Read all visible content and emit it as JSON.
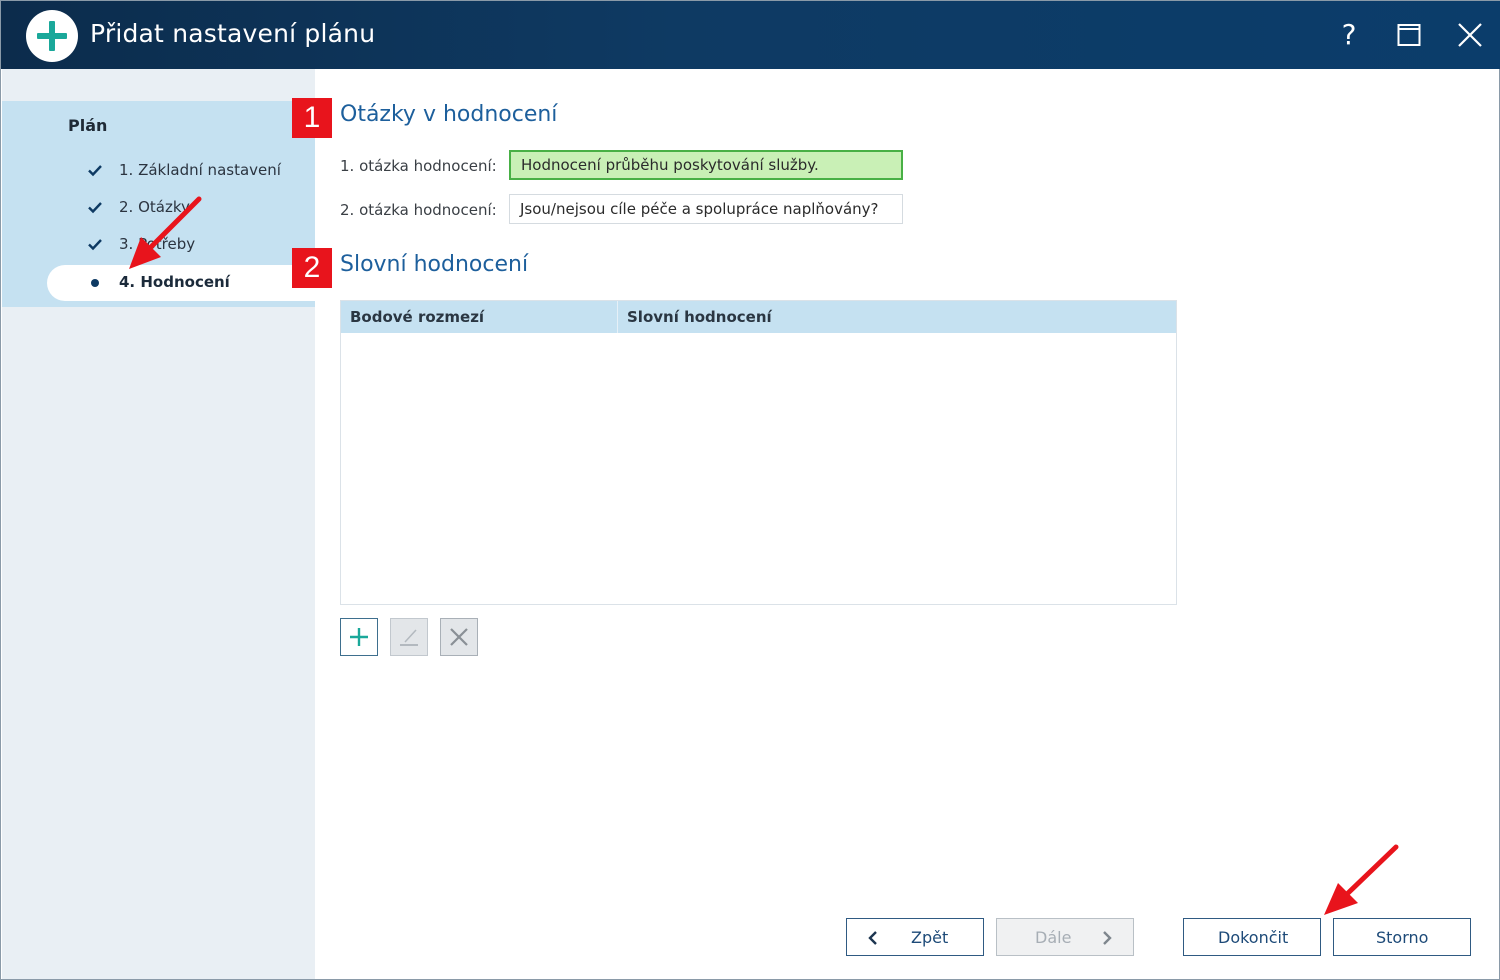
{
  "window": {
    "title": "Přidat nastavení plánu",
    "help_label": "?"
  },
  "sidebar": {
    "heading": "Plán",
    "items": [
      {
        "label": "1. Základní nastavení",
        "state": "done"
      },
      {
        "label": "2. Otázky",
        "state": "done"
      },
      {
        "label": "3. Potřeby",
        "state": "done"
      },
      {
        "label": "4. Hodnocení",
        "state": "active"
      }
    ]
  },
  "sections": {
    "questions": {
      "badge": "1",
      "title": "Otázky v hodnocení",
      "fields": [
        {
          "label": "1. otázka hodnocení:",
          "value": "Hodnocení průběhu poskytování služby."
        },
        {
          "label": "2. otázka hodnocení:",
          "value": "Jsou/nejsou cíle péče a spolupráce naplňovány?"
        }
      ]
    },
    "verbal": {
      "badge": "2",
      "title": "Slovní hodnocení",
      "columns": [
        "Bodové rozmezí",
        "Slovní hodnocení"
      ],
      "rows": []
    }
  },
  "footer": {
    "back_label": "Zpět",
    "next_label": "Dále",
    "finish_label": "Dokončit",
    "cancel_label": "Storno"
  },
  "colors": {
    "titlebar": "#0e3a63",
    "accent": "#1aa89a",
    "sidebar_panel": "#c5e1f1",
    "heading_blue": "#1d5f9c",
    "annotation_red": "#e8141c",
    "focused_field": "#c9f0b6"
  }
}
